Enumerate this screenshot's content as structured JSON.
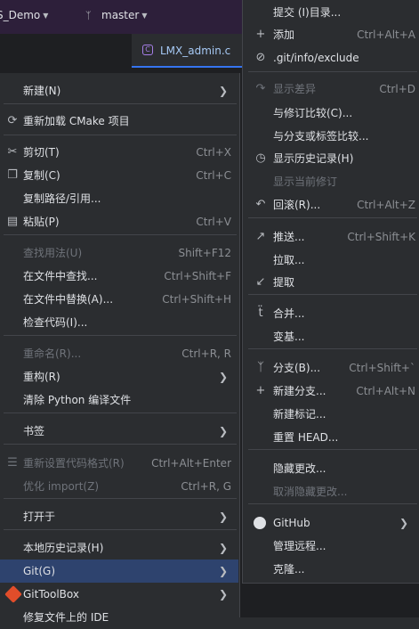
{
  "titlebar": {
    "project": "S_Demo",
    "branch": "master"
  },
  "tab": {
    "label": "LMX_admin.c",
    "icon": "c-file-icon"
  },
  "left_menu": {
    "items": [
      {
        "label": "新建(N)",
        "shortcut": "",
        "arrow": true,
        "icon": "",
        "disabled": false
      },
      {
        "label": "重新加载 CMake 项目",
        "shortcut": "",
        "arrow": false,
        "icon": "reload-icon",
        "disabled": false
      },
      {
        "label": "剪切(T)",
        "shortcut": "Ctrl+X",
        "arrow": false,
        "icon": "scissors-icon",
        "disabled": false
      },
      {
        "label": "复制(C)",
        "shortcut": "Ctrl+C",
        "arrow": false,
        "icon": "copy-icon",
        "disabled": false
      },
      {
        "label": "复制路径/引用...",
        "shortcut": "",
        "arrow": false,
        "icon": "",
        "disabled": false
      },
      {
        "label": "粘贴(P)",
        "shortcut": "Ctrl+V",
        "arrow": false,
        "icon": "paste-icon",
        "disabled": false
      },
      {
        "label": "查找用法(U)",
        "shortcut": "Shift+F12",
        "arrow": false,
        "icon": "",
        "disabled": true
      },
      {
        "label": "在文件中查找...",
        "shortcut": "Ctrl+Shift+F",
        "arrow": false,
        "icon": "",
        "disabled": false
      },
      {
        "label": "在文件中替换(A)...",
        "shortcut": "Ctrl+Shift+H",
        "arrow": false,
        "icon": "",
        "disabled": false
      },
      {
        "label": "检查代码(I)...",
        "shortcut": "",
        "arrow": false,
        "icon": "",
        "disabled": false
      },
      {
        "label": "重命名(R)...",
        "shortcut": "Ctrl+R, R",
        "arrow": false,
        "icon": "",
        "disabled": true
      },
      {
        "label": "重构(R)",
        "shortcut": "",
        "arrow": true,
        "icon": "",
        "disabled": false
      },
      {
        "label": "清除 Python 编译文件",
        "shortcut": "",
        "arrow": false,
        "icon": "",
        "disabled": false
      },
      {
        "label": "书签",
        "shortcut": "",
        "arrow": true,
        "icon": "",
        "disabled": false
      },
      {
        "label": "重新设置代码格式(R)",
        "shortcut": "Ctrl+Alt+Enter",
        "arrow": false,
        "icon": "format-icon",
        "disabled": true
      },
      {
        "label": "优化 import(Z)",
        "shortcut": "Ctrl+R, G",
        "arrow": false,
        "icon": "",
        "disabled": true
      },
      {
        "label": "打开于",
        "shortcut": "",
        "arrow": true,
        "icon": "",
        "disabled": false
      },
      {
        "label": "本地历史记录(H)",
        "shortcut": "",
        "arrow": true,
        "icon": "",
        "disabled": false
      },
      {
        "label": "Git(G)",
        "shortcut": "",
        "arrow": true,
        "icon": "",
        "disabled": false,
        "selected": true
      },
      {
        "label": "GitToolBox",
        "shortcut": "",
        "arrow": true,
        "icon": "gittoolbox-icon",
        "disabled": false
      },
      {
        "label": "修复文件上的 IDE",
        "shortcut": "",
        "arrow": false,
        "icon": "",
        "disabled": false
      }
    ]
  },
  "right_menu": {
    "items": [
      {
        "label": "提交 (I)目录...",
        "shortcut": "",
        "arrow": false,
        "icon": "",
        "disabled": false
      },
      {
        "label": "添加",
        "shortcut": "Ctrl+Alt+A",
        "arrow": false,
        "icon": "plus-icon",
        "disabled": false
      },
      {
        "label": ".git/info/exclude",
        "shortcut": "",
        "arrow": false,
        "icon": "exclude-icon",
        "disabled": false
      },
      {
        "label": "显示差异",
        "shortcut": "Ctrl+D",
        "arrow": false,
        "icon": "diff-arrow-icon",
        "disabled": true
      },
      {
        "label": "与修订比较(C)...",
        "shortcut": "",
        "arrow": false,
        "icon": "",
        "disabled": false
      },
      {
        "label": "与分支或标签比较...",
        "shortcut": "",
        "arrow": false,
        "icon": "",
        "disabled": false
      },
      {
        "label": "显示历史记录(H)",
        "shortcut": "",
        "arrow": false,
        "icon": "clock-icon",
        "disabled": false
      },
      {
        "label": "显示当前修订",
        "shortcut": "",
        "arrow": false,
        "icon": "",
        "disabled": true
      },
      {
        "label": "回滚(R)...",
        "shortcut": "Ctrl+Alt+Z",
        "arrow": false,
        "icon": "rollback-icon",
        "disabled": false
      },
      {
        "label": "推送...",
        "shortcut": "Ctrl+Shift+K",
        "arrow": false,
        "icon": "push-arrow-icon",
        "disabled": false
      },
      {
        "label": "拉取...",
        "shortcut": "",
        "arrow": false,
        "icon": "",
        "disabled": false
      },
      {
        "label": "提取",
        "shortcut": "",
        "arrow": false,
        "icon": "fetch-arrow-icon",
        "disabled": false
      },
      {
        "label": "合并...",
        "shortcut": "",
        "arrow": false,
        "icon": "merge-icon",
        "disabled": false
      },
      {
        "label": "变基...",
        "shortcut": "",
        "arrow": false,
        "icon": "",
        "disabled": false
      },
      {
        "label": "分支(B)...",
        "shortcut": "Ctrl+Shift+`",
        "arrow": false,
        "icon": "branch-icon",
        "disabled": false
      },
      {
        "label": "新建分支...",
        "shortcut": "Ctrl+Alt+N",
        "arrow": false,
        "icon": "plus-icon",
        "disabled": false
      },
      {
        "label": "新建标记...",
        "shortcut": "",
        "arrow": false,
        "icon": "",
        "disabled": false
      },
      {
        "label": "重置 HEAD...",
        "shortcut": "",
        "arrow": false,
        "icon": "",
        "disabled": false
      },
      {
        "label": "隐藏更改...",
        "shortcut": "",
        "arrow": false,
        "icon": "",
        "disabled": false
      },
      {
        "label": "取消隐藏更改...",
        "shortcut": "",
        "arrow": false,
        "icon": "",
        "disabled": true
      },
      {
        "label": "GitHub",
        "shortcut": "",
        "arrow": true,
        "icon": "github-icon",
        "disabled": false
      },
      {
        "label": "管理远程...",
        "shortcut": "",
        "arrow": false,
        "icon": "",
        "disabled": false
      },
      {
        "label": "克隆...",
        "shortcut": "",
        "arrow": false,
        "icon": "",
        "disabled": false
      }
    ]
  },
  "colors": {
    "menu_bg": "#2b2d30",
    "selected_bg": "#2e436e",
    "disabled_text": "#6f737a",
    "shortcut_text": "#8c8f94",
    "accent": "#3574f0"
  }
}
